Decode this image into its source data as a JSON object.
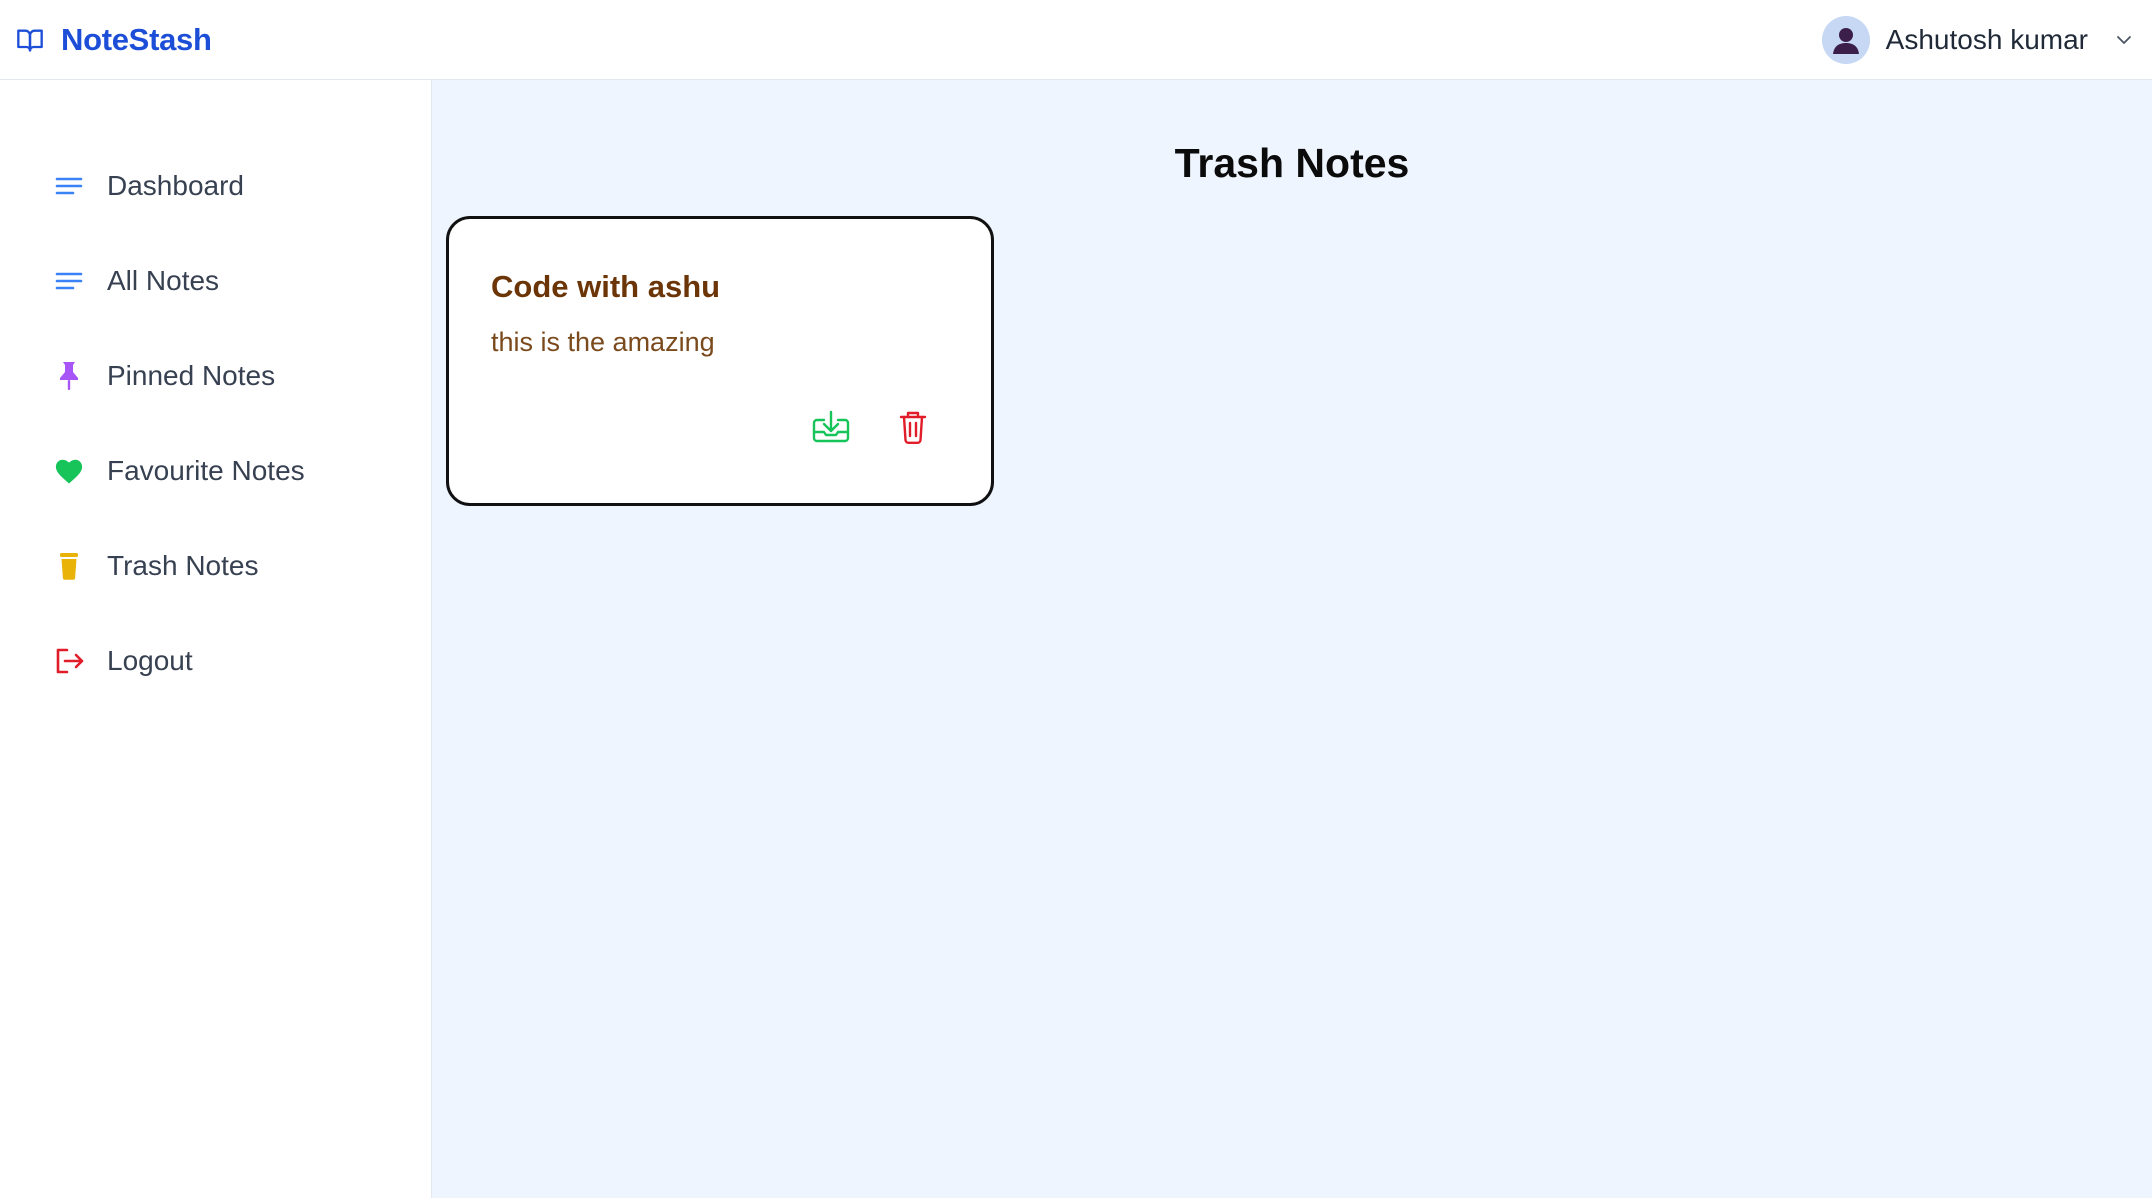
{
  "header": {
    "brand": "NoteStash",
    "user_name": "Ashutosh kumar"
  },
  "sidebar": {
    "items": [
      {
        "label": "Dashboard",
        "icon": "lines-icon",
        "color": "#3b82f6"
      },
      {
        "label": "All Notes",
        "icon": "lines-icon",
        "color": "#3b82f6"
      },
      {
        "label": "Pinned Notes",
        "icon": "pin-icon",
        "color": "#a855f7"
      },
      {
        "label": "Favourite Notes",
        "icon": "heart-icon",
        "color": "#16c45a"
      },
      {
        "label": "Trash Notes",
        "icon": "trash-icon",
        "color": "#eab308"
      },
      {
        "label": "Logout",
        "icon": "logout-icon",
        "color": "#e11d2a"
      }
    ]
  },
  "main": {
    "title": "Trash Notes",
    "notes": [
      {
        "title": "Code with ashu",
        "body": "this is the amazing"
      }
    ]
  },
  "colors": {
    "brand": "#1d4ed8",
    "restore": "#16c45a",
    "delete": "#e11d2a",
    "main_bg": "#eef5fe",
    "note_title": "#6b3508"
  }
}
